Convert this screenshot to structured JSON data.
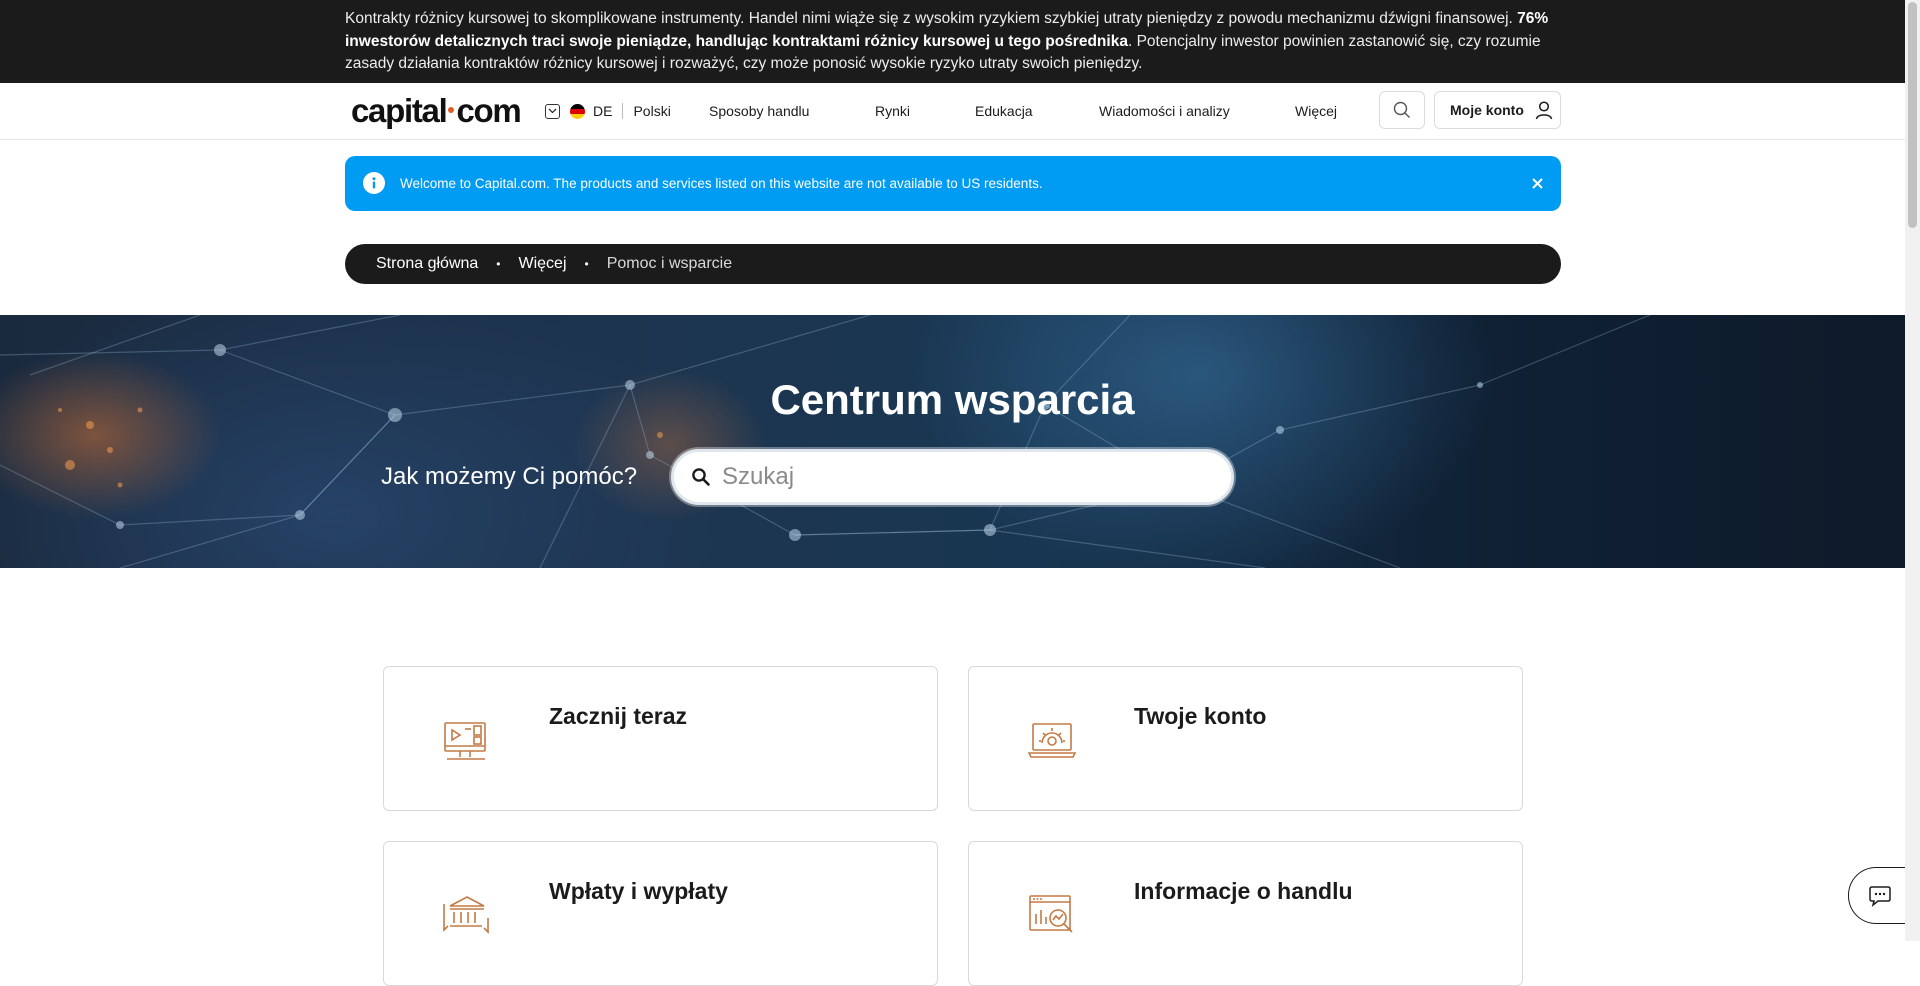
{
  "risk_warning": {
    "part1": "Kontrakty różnicy kursowej to skomplikowane instrumenty. Handel nimi wiąże się z wysokim ryzykiem szybkiej utraty pieniędzy z powodu mechanizmu dźwigni finansowej. ",
    "bold": "76% inwestorów detalicznych traci swoje pieniądze, handlując kontraktami różnicy kursowej u tego pośrednika",
    "part2": ". Potencjalny inwestor powinien zastanowić się, czy rozumie zasady działania kontraktów różnicy kursowej i rozważyć, czy może ponosić wysokie ryzyko utraty swoich pieniędzy."
  },
  "header": {
    "logo_left": "capital",
    "logo_right": "com",
    "country_code": "DE",
    "language": "Polski",
    "nav": [
      "Sposoby handlu",
      "Rynki",
      "Edukacja",
      "Wiadomości i analizy",
      "Więcej"
    ],
    "account_label": "Moje konto"
  },
  "banner": {
    "text": "Welcome to Capital.com. The products and services listed on this website are not available to US residents."
  },
  "breadcrumb": {
    "items": [
      "Strona główna",
      "Więcej",
      "Pomoc i wsparcie"
    ]
  },
  "hero": {
    "title": "Centrum wsparcia",
    "question": "Jak możemy Ci pomóc?",
    "search_placeholder": "Szukaj"
  },
  "cards": [
    {
      "title": "Zacznij teraz",
      "icon": "video-screen-icon"
    },
    {
      "title": "Twoje konto",
      "icon": "laptop-settings-icon"
    },
    {
      "title": "Wpłaty i wypłaty",
      "icon": "bank-transfer-icon"
    },
    {
      "title": "Informacje o handlu",
      "icon": "chart-magnifier-icon"
    }
  ],
  "colors": {
    "accent_orange": "#c47a45",
    "banner_blue": "#009bf2",
    "dark": "#1b1b1b",
    "logo_dot": "#e35b29"
  }
}
